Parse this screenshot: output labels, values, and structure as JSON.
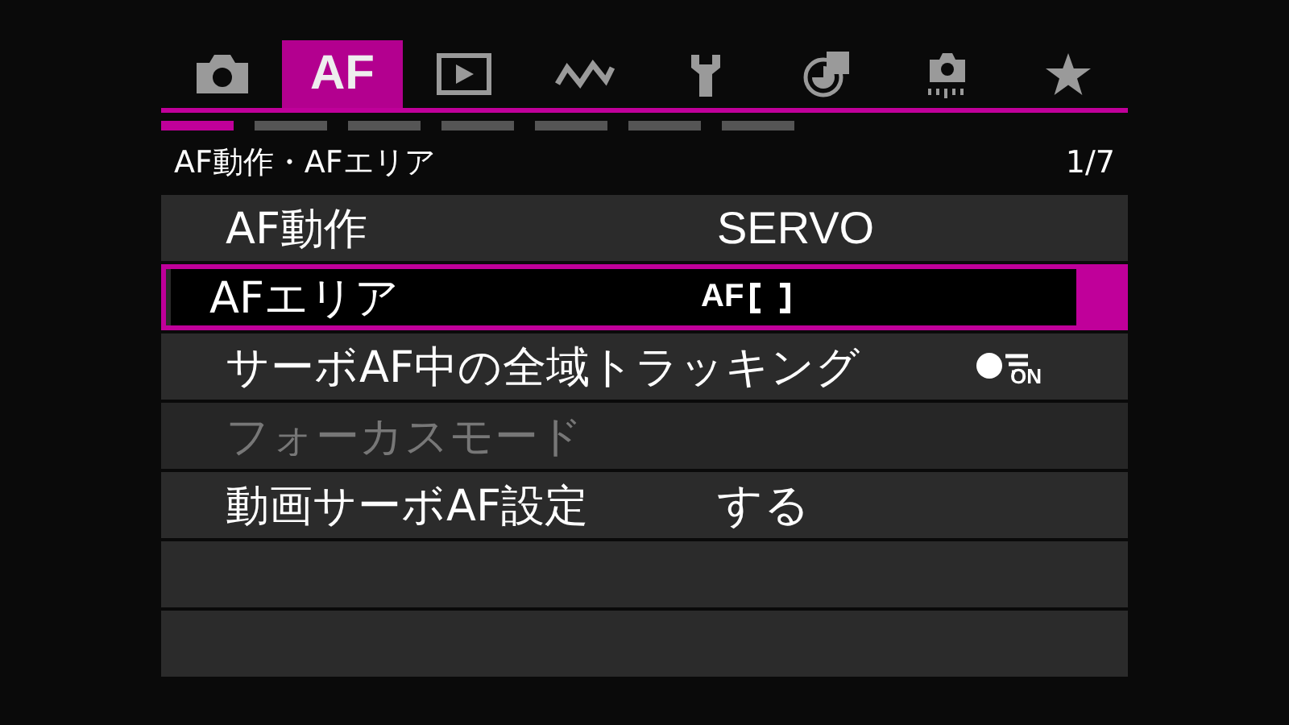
{
  "tabs": [
    {
      "kind": "camera",
      "selected": false
    },
    {
      "kind": "text",
      "label": "AF",
      "selected": true
    },
    {
      "kind": "play",
      "selected": false
    },
    {
      "kind": "wave",
      "selected": false
    },
    {
      "kind": "wrench",
      "selected": false
    },
    {
      "kind": "chart",
      "selected": false
    },
    {
      "kind": "sensor",
      "selected": false
    },
    {
      "kind": "star",
      "selected": false
    }
  ],
  "pages": [
    {
      "selected": true
    },
    {
      "selected": false
    },
    {
      "selected": false
    },
    {
      "selected": false
    },
    {
      "selected": false
    },
    {
      "selected": false
    },
    {
      "selected": false
    }
  ],
  "header": {
    "title": "AF動作・AFエリア",
    "page": "1/7"
  },
  "rows": [
    {
      "name": "AF動作",
      "kind": "text",
      "value": "SERVO",
      "selected": false,
      "disabled": false
    },
    {
      "name": "AFエリア",
      "kind": "af-area",
      "value": "AF",
      "selected": true,
      "disabled": false
    },
    {
      "name": "サーボAF中の全域トラッキング",
      "kind": "tracking",
      "value": "ON",
      "selected": false,
      "disabled": false
    },
    {
      "name": "フォーカスモード",
      "kind": "none",
      "selected": false,
      "disabled": true
    },
    {
      "name": "動画サーボAF設定",
      "kind": "text",
      "value": "する",
      "selected": false,
      "disabled": false
    },
    {
      "kind": "empty"
    },
    {
      "kind": "empty"
    }
  ]
}
